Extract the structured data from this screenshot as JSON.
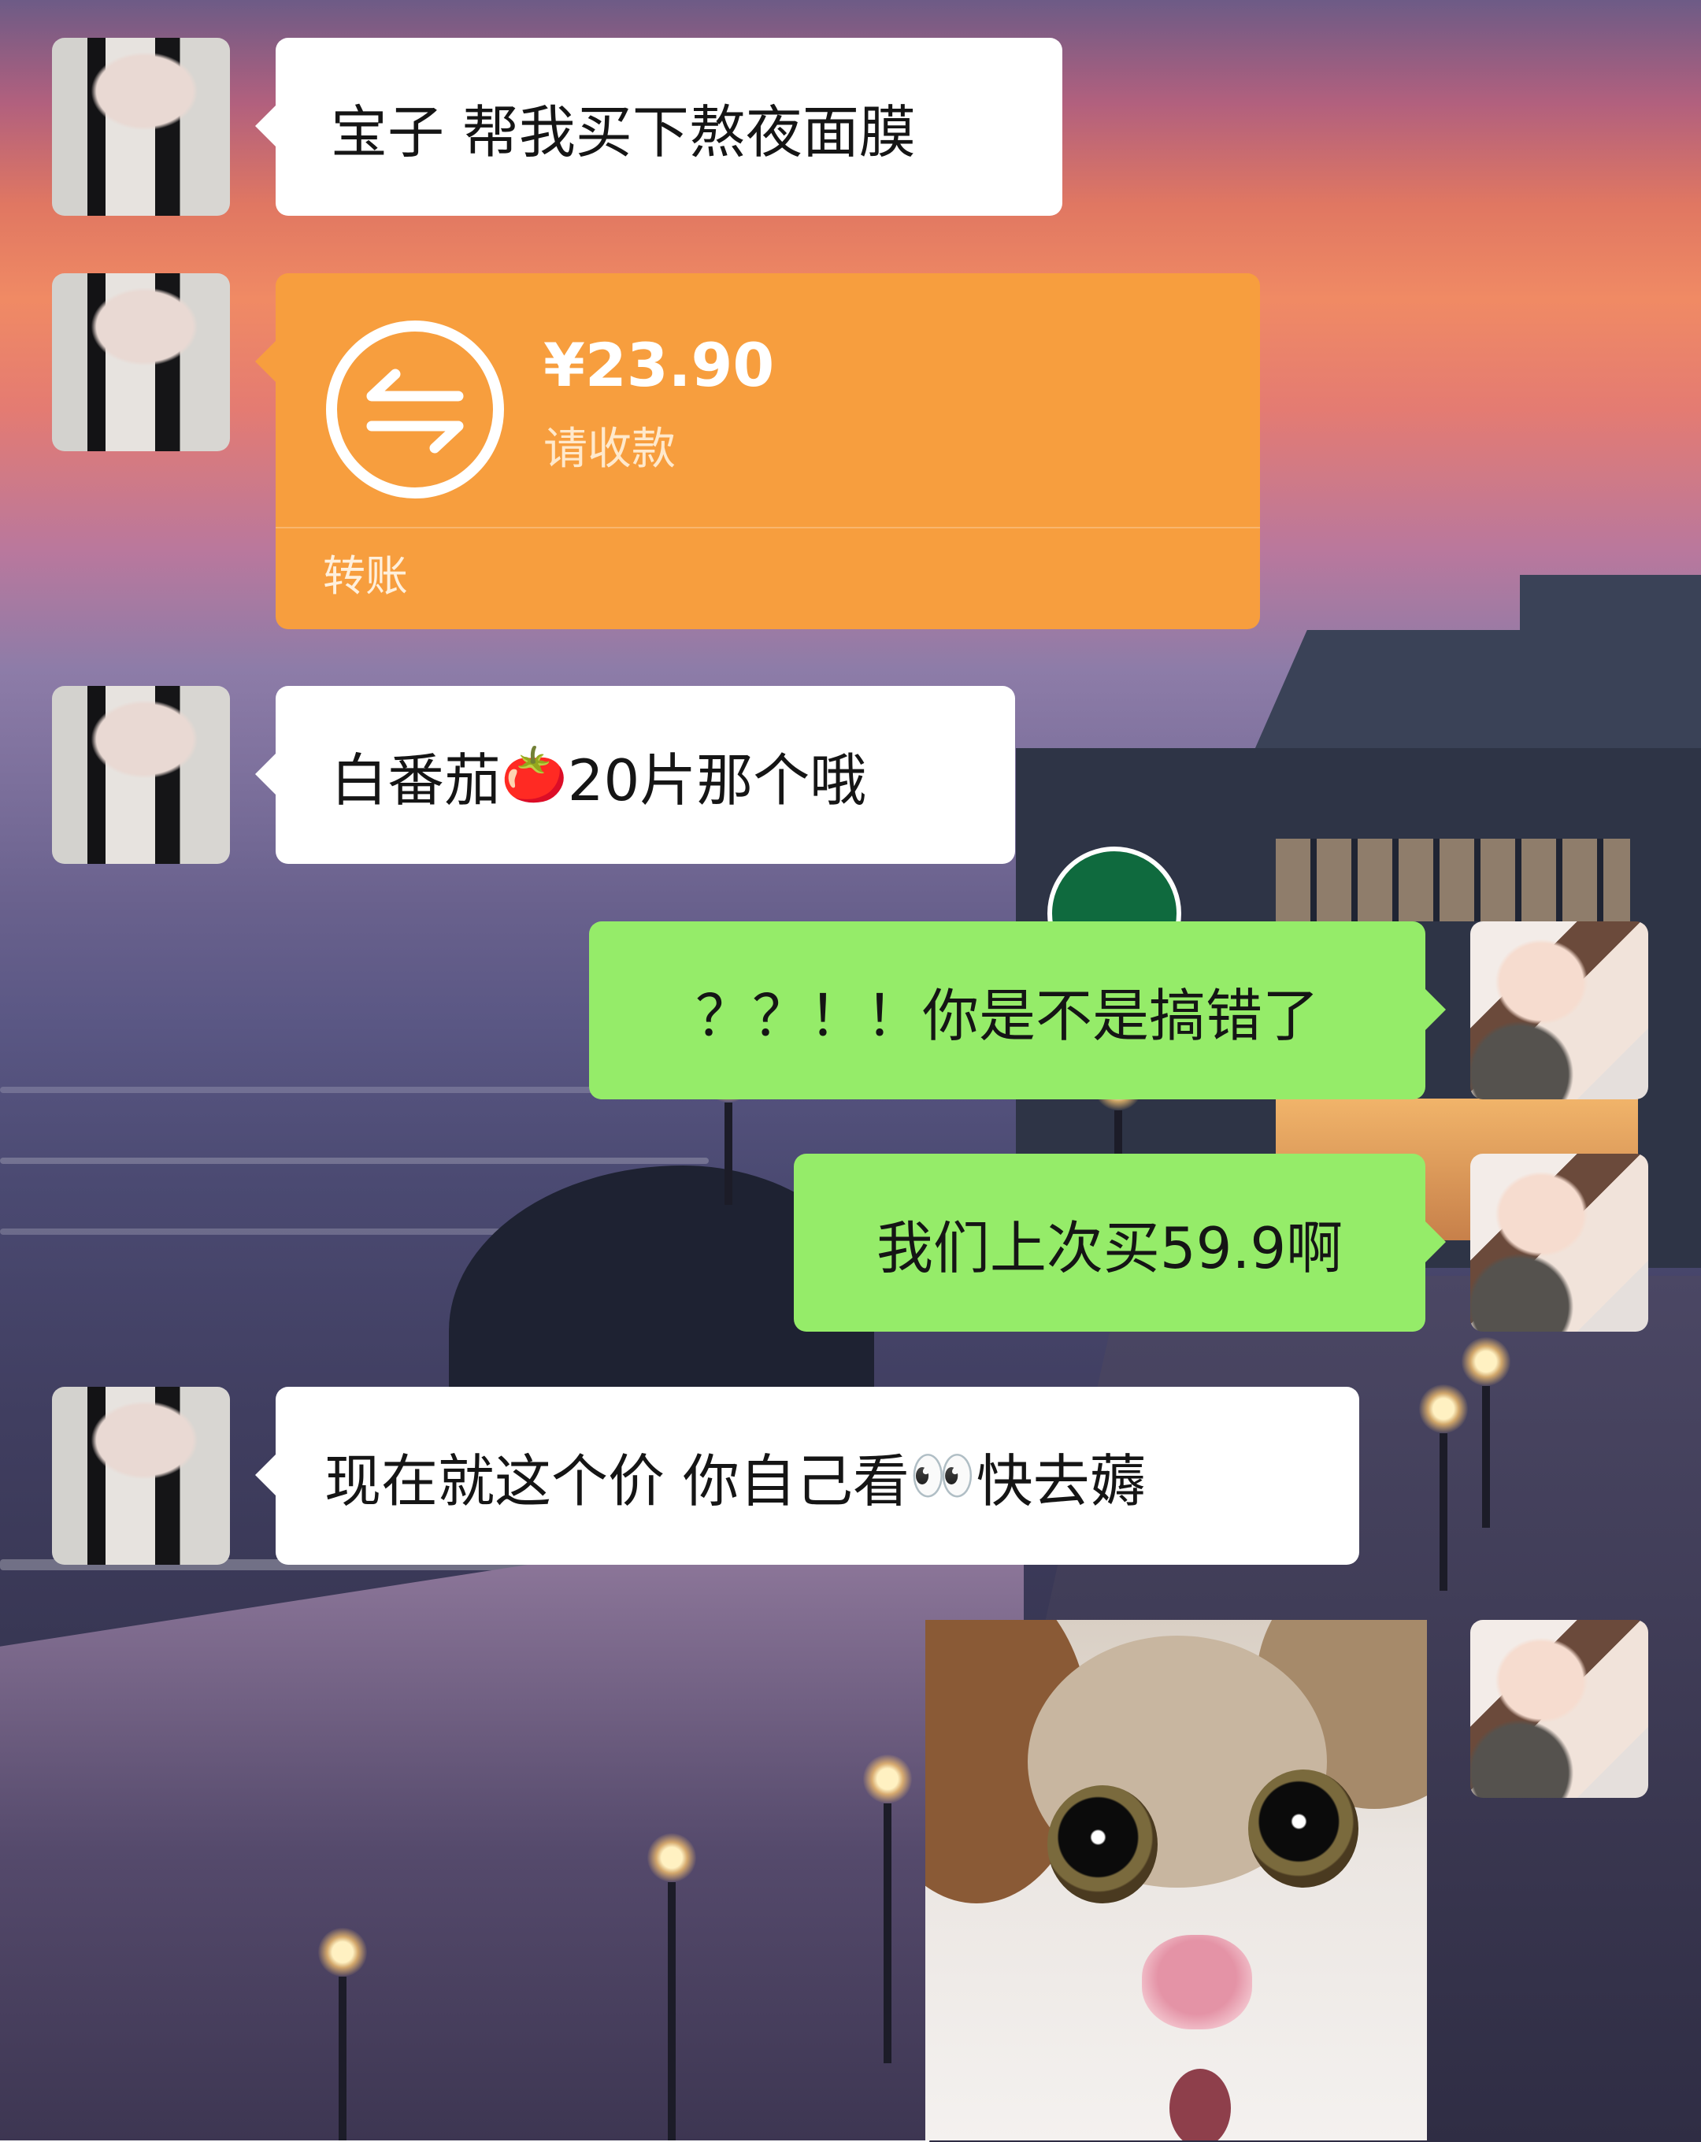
{
  "background": {
    "description_icons": [
      "sunset-sky",
      "ocean",
      "coffee-shop",
      "street-lamp"
    ]
  },
  "colors": {
    "incoming_bubble": "#ffffff",
    "outgoing_bubble": "#95ec69",
    "transfer_card": "#f79e3e"
  },
  "messages": [
    {
      "sender": "contact",
      "type": "text",
      "text": "宝子 帮我买下熬夜面膜"
    },
    {
      "sender": "contact",
      "type": "transfer",
      "amount": "¥23.90",
      "status": "请收款",
      "label": "转账",
      "icon": "transfer-arrows-icon"
    },
    {
      "sender": "contact",
      "type": "text",
      "text": "白番茄",
      "emoji": "🍅",
      "text_after": "20片那个哦"
    },
    {
      "sender": "me",
      "type": "text",
      "text": "？？！！你是不是搞错了"
    },
    {
      "sender": "me",
      "type": "text",
      "text": "我们上次买59.9啊"
    },
    {
      "sender": "contact",
      "type": "text",
      "text": "现在就这个价 你自己看",
      "emoji": "👀",
      "text_after": "快去薅"
    },
    {
      "sender": "me",
      "type": "image",
      "image": "surprised-cat-photo"
    }
  ]
}
